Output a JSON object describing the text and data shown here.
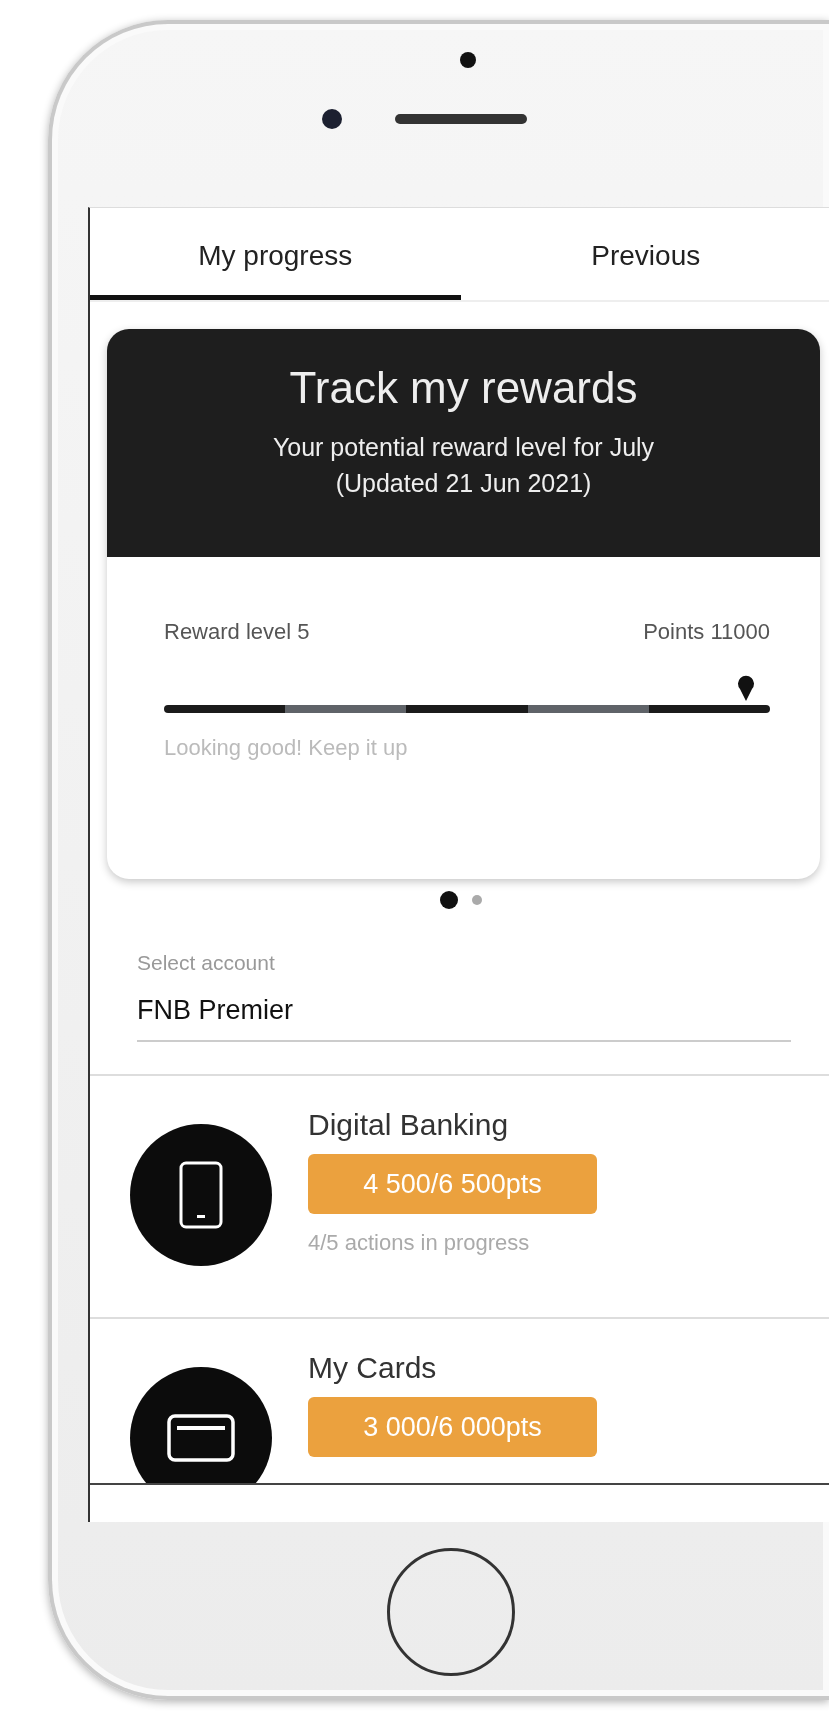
{
  "tabs": [
    {
      "label": "My progress",
      "selected": true
    },
    {
      "label": "Previous",
      "selected": false
    }
  ],
  "reward_card": {
    "title": "Track my rewards",
    "subtitle": "Your potential reward level for July",
    "updated": "(Updated 21 Jun 2021)",
    "level_label": "Reward level 5",
    "points_label": "Points 11000",
    "progress": {
      "level": 0.96
    },
    "message": "Looking good! Keep it up"
  },
  "pager": [
    {
      "selected": true
    },
    {
      "selected": false
    }
  ],
  "account": {
    "label": "Select account",
    "value": "FNB Premier"
  },
  "categories": [
    {
      "kind": "phone",
      "title": "Digital Banking",
      "points": "4 500/6 500pts",
      "status": "4/5 actions in progress"
    },
    {
      "kind": "card",
      "title": "My Cards",
      "points": "3 000/6 000pts"
    }
  ]
}
